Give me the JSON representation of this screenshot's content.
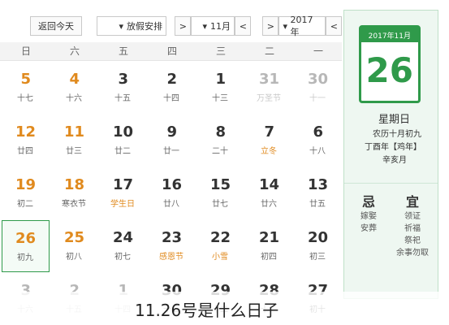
{
  "colors": {
    "accent": "#2f9a4a",
    "holiday": "#e08a1e",
    "festival": "#e08a1e",
    "weekend": "#e08a1e",
    "text": "#333333"
  },
  "today_card": {
    "year_month": "2017年11月",
    "day": "26",
    "weekday": "星期日",
    "lunar_line": "农历十月初九",
    "ganzhi_line": "丁酉年【鸡年】",
    "extra_line": "辛亥月"
  },
  "yi_ji": {
    "yi_title": "宜",
    "yi_items": [
      "领证",
      "祈福",
      "祭祀",
      "余事勿取"
    ],
    "ji_title": "忌",
    "ji_items": [
      "嫁娶",
      "安葬"
    ]
  },
  "toolbar": {
    "today_btn": "返回今天",
    "holiday_select": "放假安排",
    "month_value": "11月",
    "year_value": "2017年",
    "prev": "<",
    "next": ">",
    "dropdown": "▾"
  },
  "weekdays": [
    "一",
    "二",
    "三",
    "四",
    "五",
    "六",
    "日"
  ],
  "rows": [
    [
      {
        "num": "30",
        "lunar": "十一",
        "cls": "faded"
      },
      {
        "num": "31",
        "lunar": "万圣节",
        "cls": "faded"
      },
      {
        "num": "1",
        "lunar": "十三",
        "cls": ""
      },
      {
        "num": "2",
        "lunar": "十四",
        "cls": ""
      },
      {
        "num": "3",
        "lunar": "十五",
        "cls": ""
      },
      {
        "num": "4",
        "lunar": "十六",
        "cls": "weekend"
      },
      {
        "num": "5",
        "lunar": "十七",
        "cls": "weekend"
      }
    ],
    [
      {
        "num": "6",
        "lunar": "十八",
        "cls": ""
      },
      {
        "num": "7",
        "lunar": "立冬",
        "cls": "term"
      },
      {
        "num": "8",
        "lunar": "二十",
        "cls": ""
      },
      {
        "num": "9",
        "lunar": "廿一",
        "cls": ""
      },
      {
        "num": "10",
        "lunar": "廿二",
        "cls": ""
      },
      {
        "num": "11",
        "lunar": "廿三",
        "cls": "weekend"
      },
      {
        "num": "12",
        "lunar": "廿四",
        "cls": "weekend"
      }
    ],
    [
      {
        "num": "13",
        "lunar": "廿五",
        "cls": ""
      },
      {
        "num": "14",
        "lunar": "廿六",
        "cls": ""
      },
      {
        "num": "15",
        "lunar": "廿七",
        "cls": ""
      },
      {
        "num": "16",
        "lunar": "廿八",
        "cls": ""
      },
      {
        "num": "17",
        "lunar": "学生日",
        "cls": "term"
      },
      {
        "num": "18",
        "lunar": "寒衣节",
        "cls": "weekend"
      },
      {
        "num": "19",
        "lunar": "初二",
        "cls": "weekend"
      }
    ],
    [
      {
        "num": "20",
        "lunar": "初三",
        "cls": ""
      },
      {
        "num": "21",
        "lunar": "初四",
        "cls": ""
      },
      {
        "num": "22",
        "lunar": "小雪",
        "cls": "term"
      },
      {
        "num": "23",
        "lunar": "感恩节",
        "cls": "term"
      },
      {
        "num": "24",
        "lunar": "初七",
        "cls": ""
      },
      {
        "num": "25",
        "lunar": "初八",
        "cls": "weekend"
      },
      {
        "num": "26",
        "lunar": "初九",
        "cls": "weekend today"
      }
    ],
    [
      {
        "num": "27",
        "lunar": "初十",
        "cls": ""
      },
      {
        "num": "28",
        "lunar": "十一",
        "cls": ""
      },
      {
        "num": "29",
        "lunar": "十二",
        "cls": ""
      },
      {
        "num": "30",
        "lunar": "十三",
        "cls": ""
      },
      {
        "num": "1",
        "lunar": "十四",
        "cls": "faded"
      },
      {
        "num": "2",
        "lunar": "十五",
        "cls": "faded"
      },
      {
        "num": "3",
        "lunar": "十六",
        "cls": "faded"
      }
    ]
  ],
  "caption": "11.26号是什么日子"
}
